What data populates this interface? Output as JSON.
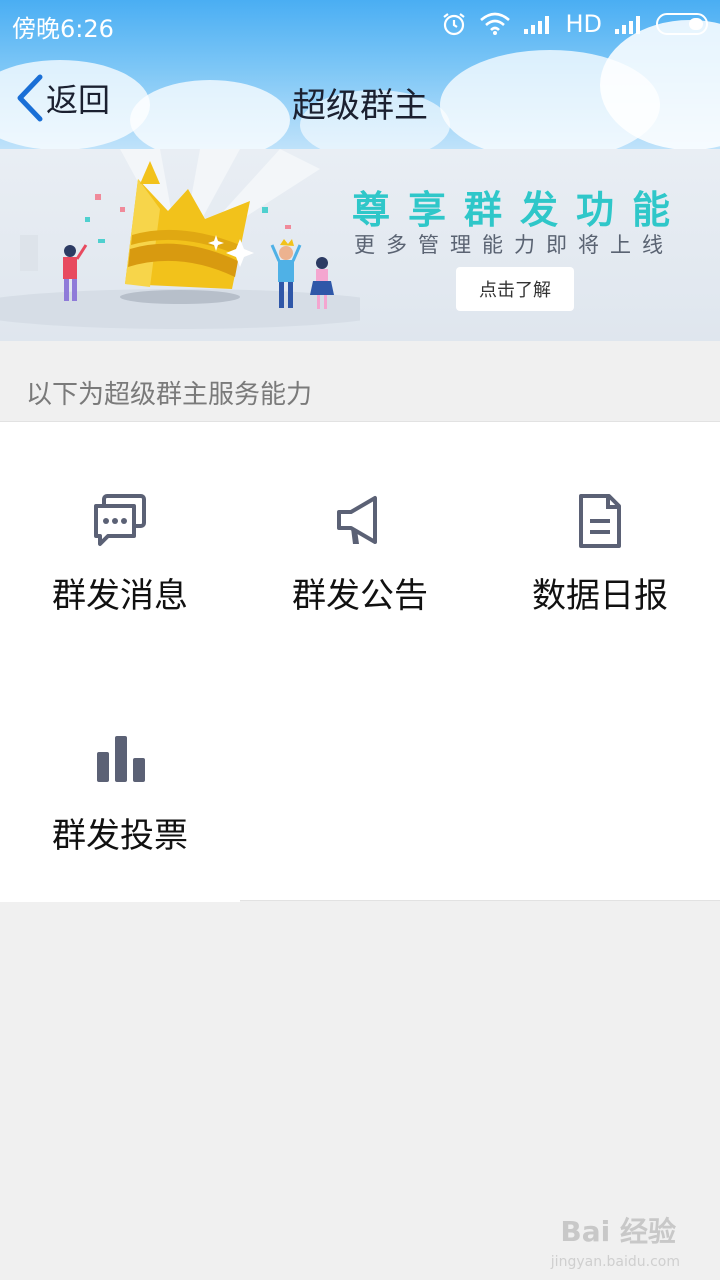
{
  "status_bar": {
    "time": "傍晚6:26",
    "network": "HD",
    "icons": [
      "alarm-icon",
      "wifi-icon",
      "signal-icon",
      "signal-icon",
      "battery-icon"
    ]
  },
  "nav": {
    "back_label": "返回",
    "title": "超级群主"
  },
  "banner": {
    "headline": "尊享群发功能",
    "subtitle": "更多管理能力即将上线",
    "button_label": "点击了解"
  },
  "section": {
    "title": "以下为超级群主服务能力"
  },
  "features": [
    {
      "label": "群发消息",
      "icon": "chat-bubbles-icon"
    },
    {
      "label": "群发公告",
      "icon": "megaphone-icon"
    },
    {
      "label": "数据日报",
      "icon": "document-icon"
    },
    {
      "label": "群发投票",
      "icon": "bar-chart-icon"
    }
  ],
  "watermark": {
    "brand": "Bai 经验",
    "url": "jingyan.baidu.com"
  },
  "colors": {
    "header_blue": "#4aaef3",
    "icon_gray": "#5b6175",
    "banner_teal": "#2fc7c9",
    "back_blue": "#1a6fd6"
  }
}
